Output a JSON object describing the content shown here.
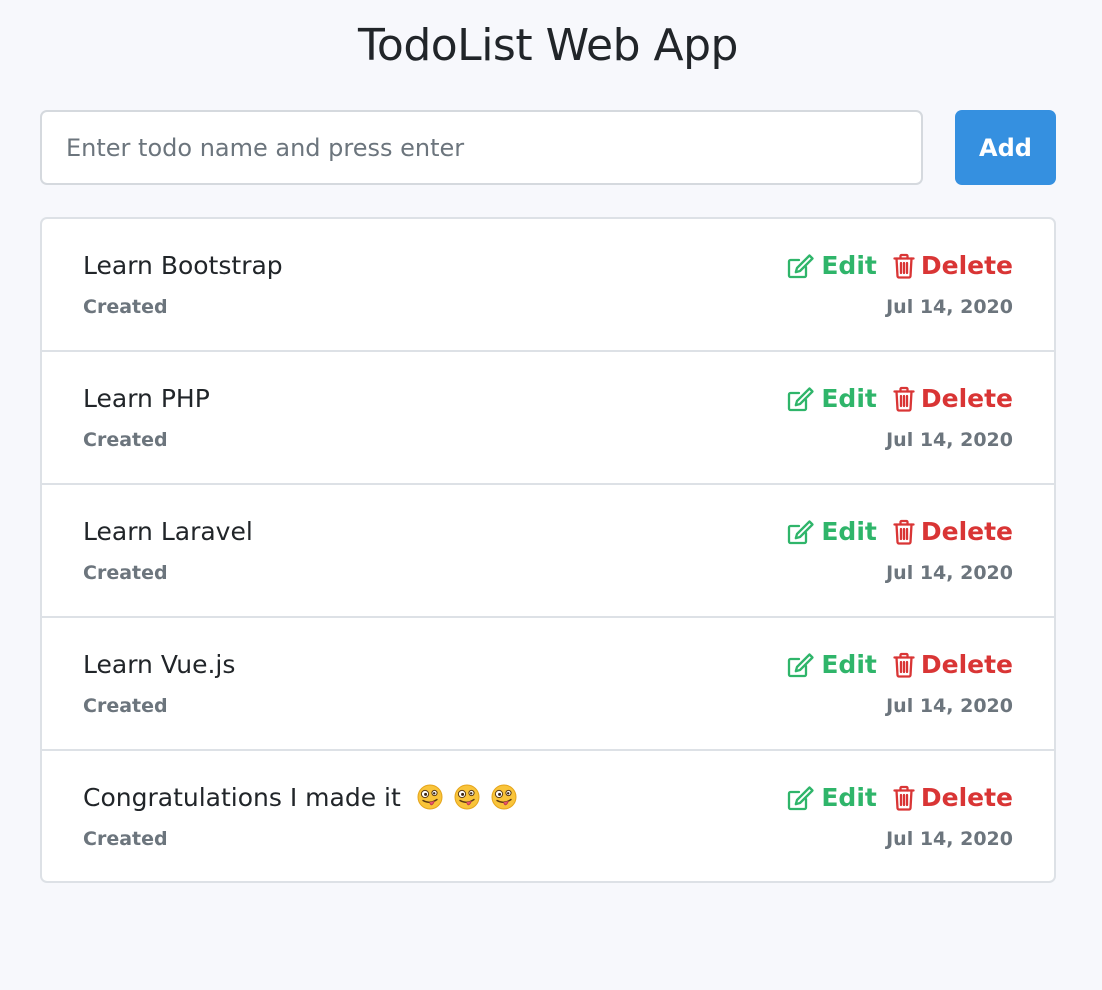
{
  "app": {
    "title": "TodoList Web App"
  },
  "form": {
    "input_value": "",
    "input_placeholder": "Enter todo name and press enter",
    "add_label": "Add"
  },
  "colors": {
    "accent": "#3590e0",
    "edit": "#2fb56a",
    "delete": "#d93535",
    "muted": "#6c757d",
    "background": "#f7f8fc"
  },
  "actions": {
    "edit_label": "Edit",
    "edit_icon": "edit-icon",
    "delete_label": "Delete",
    "delete_icon": "trash-icon"
  },
  "todos": [
    {
      "name": "Learn Bootstrap",
      "status": "Created",
      "date": "Jul 14, 2020",
      "emoji": []
    },
    {
      "name": "Learn PHP",
      "status": "Created",
      "date": "Jul 14, 2020",
      "emoji": []
    },
    {
      "name": "Learn Laravel",
      "status": "Created",
      "date": "Jul 14, 2020",
      "emoji": []
    },
    {
      "name": "Learn Vue.js",
      "status": "Created",
      "date": "Jul 14, 2020",
      "emoji": []
    },
    {
      "name": "Congratulations I made it",
      "status": "Created",
      "date": "Jul 14, 2020",
      "emoji": [
        "zany-face-emoji",
        "zany-face-emoji",
        "zany-face-emoji"
      ]
    }
  ]
}
